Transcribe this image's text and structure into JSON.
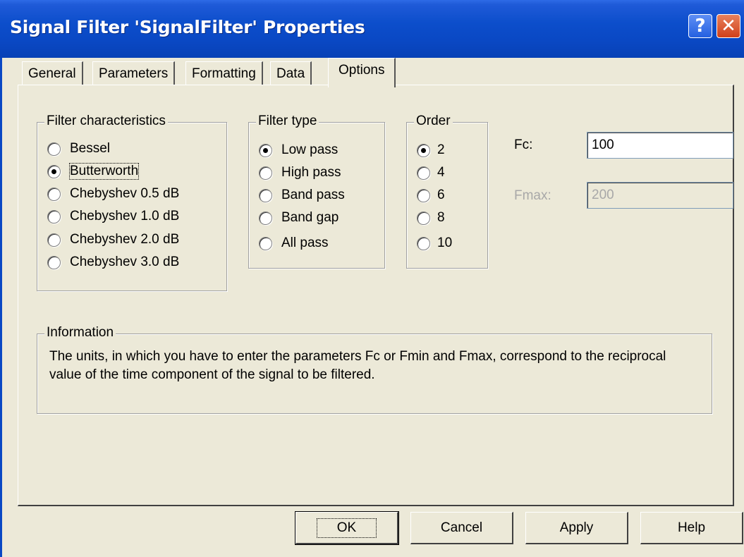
{
  "window": {
    "title": "Signal Filter 'SignalFilter' Properties",
    "help_glyph": "?",
    "close_glyph": "✕"
  },
  "tabs": [
    {
      "label": "General",
      "active": false
    },
    {
      "label": "Parameters",
      "active": false
    },
    {
      "label": "Formatting",
      "active": false
    },
    {
      "label": "Data",
      "active": false
    },
    {
      "label": "Options",
      "active": true
    }
  ],
  "filter_characteristics": {
    "legend": "Filter characteristics",
    "options": [
      {
        "label": "Bessel",
        "selected": false
      },
      {
        "label": "Butterworth",
        "selected": true
      },
      {
        "label": "Chebyshev 0.5 dB",
        "selected": false
      },
      {
        "label": "Chebyshev 1.0 dB",
        "selected": false
      },
      {
        "label": "Chebyshev 2.0 dB",
        "selected": false
      },
      {
        "label": "Chebyshev 3.0 dB",
        "selected": false
      }
    ]
  },
  "filter_type": {
    "legend": "Filter type",
    "options": [
      {
        "label": "Low pass",
        "selected": true
      },
      {
        "label": "High pass",
        "selected": false
      },
      {
        "label": "Band pass",
        "selected": false
      },
      {
        "label": "Band gap",
        "selected": false
      },
      {
        "label": "All pass",
        "selected": false
      }
    ]
  },
  "order": {
    "legend": "Order",
    "options": [
      {
        "label": "2",
        "selected": true
      },
      {
        "label": "4",
        "selected": false
      },
      {
        "label": "6",
        "selected": false
      },
      {
        "label": "8",
        "selected": false
      },
      {
        "label": "10",
        "selected": false
      }
    ]
  },
  "fields": {
    "fc_label": "Fc:",
    "fc_value": "100",
    "fmax_label": "Fmax:",
    "fmax_value": "200"
  },
  "information": {
    "legend": "Information",
    "text": "The units, in which you have to enter the parameters Fc or Fmin and Fmax, correspond to the reciprocal value of the time component of the signal to be filtered."
  },
  "buttons": {
    "ok": "OK",
    "cancel": "Cancel",
    "apply": "Apply",
    "help": "Help"
  },
  "colors": {
    "titlebar": "#0a48c4",
    "face": "#ece9d8",
    "disabled_text": "#a8a8a8"
  }
}
